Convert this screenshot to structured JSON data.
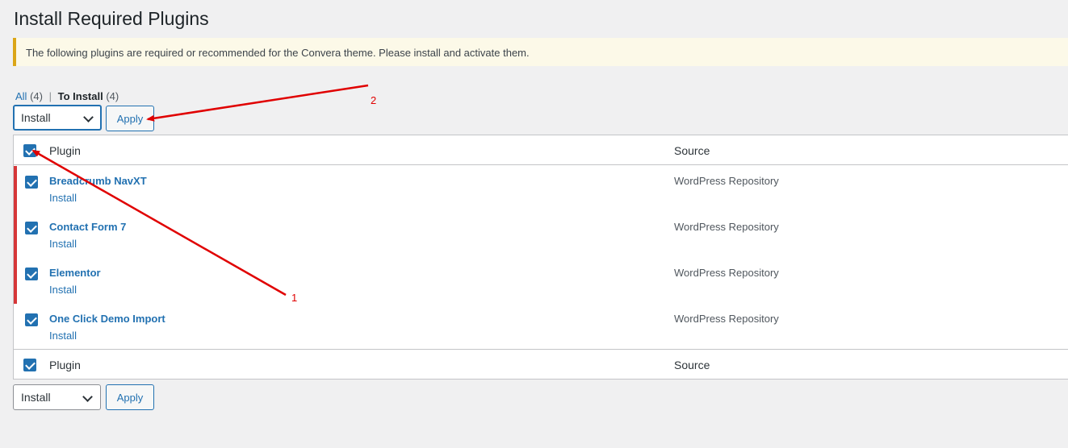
{
  "page": {
    "title": "Install Required Plugins",
    "notice": "The following plugins are required or recommended for the Convera theme. Please install and activate them."
  },
  "filters": {
    "all_label": "All",
    "all_count": "(4)",
    "to_install_label": "To Install",
    "to_install_count": "(4)"
  },
  "bulk_top": {
    "action": "Install",
    "apply_label": "Apply"
  },
  "bulk_bottom": {
    "action": "Install",
    "apply_label": "Apply"
  },
  "table": {
    "columns": {
      "plugin": "Plugin",
      "source": "Source"
    },
    "rows": [
      {
        "name": "Breadcrumb NavXT",
        "action": "Install",
        "source": "WordPress Repository",
        "checked": true
      },
      {
        "name": "Contact Form 7",
        "action": "Install",
        "source": "WordPress Repository",
        "checked": true
      },
      {
        "name": "Elementor",
        "action": "Install",
        "source": "WordPress Repository",
        "checked": true
      },
      {
        "name": "One Click Demo Import",
        "action": "Install",
        "source": "WordPress Repository",
        "checked": true
      }
    ]
  },
  "annotations": {
    "label_1": "1",
    "label_2": "2",
    "color": "#e00000"
  },
  "colors": {
    "accent": "#2271b1",
    "notice_border": "#dba617",
    "inactive_border": "#d63638"
  }
}
